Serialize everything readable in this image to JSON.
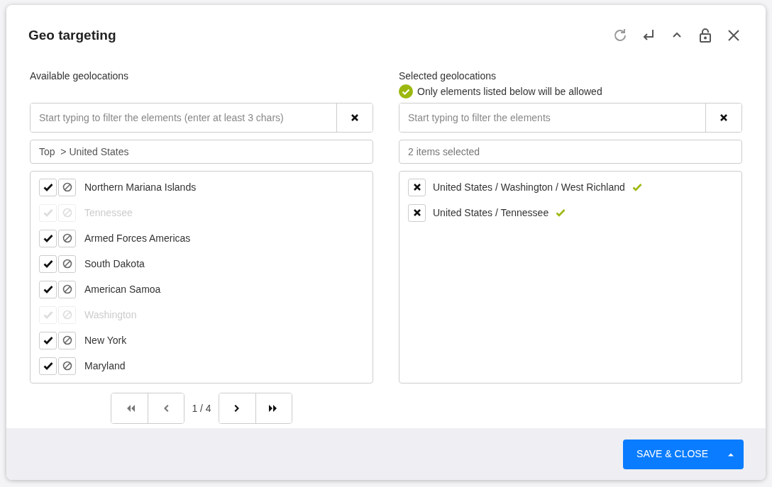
{
  "dialog": {
    "title": "Geo targeting"
  },
  "available": {
    "label": "Available geolocations",
    "filter": {
      "placeholder": "Start typing to filter the elements (enter at least 3 chars)"
    },
    "breadcrumb": "Top  > United States",
    "items": [
      {
        "name": "Northern Mariana Islands",
        "disabled": false
      },
      {
        "name": "Tennessee",
        "disabled": true
      },
      {
        "name": "Armed Forces Americas",
        "disabled": false
      },
      {
        "name": "South Dakota",
        "disabled": false
      },
      {
        "name": "American Samoa",
        "disabled": false
      },
      {
        "name": "Washington",
        "disabled": true
      },
      {
        "name": "New York",
        "disabled": false
      },
      {
        "name": "Maryland",
        "disabled": false
      }
    ],
    "pager": {
      "page": "1 / 4",
      "buttons": [
        {
          "kind": "first",
          "disabled": true
        },
        {
          "kind": "prev",
          "disabled": true
        },
        {
          "kind": "next",
          "disabled": false
        },
        {
          "kind": "last",
          "disabled": false
        }
      ]
    }
  },
  "selected": {
    "label": "Selected geolocations",
    "notice": "Only elements listed below will be allowed",
    "filter": {
      "placeholder": "Start typing to filter the elements"
    },
    "summary": {
      "placeholder": "2 items selected"
    },
    "items": [
      {
        "name": "United States / Washington / West Richland"
      },
      {
        "name": "United States / Tennessee"
      }
    ]
  },
  "footer": {
    "button": "SAVE & CLOSE"
  }
}
